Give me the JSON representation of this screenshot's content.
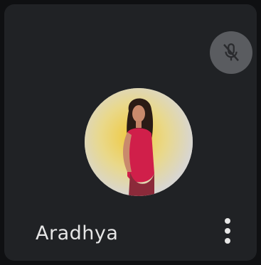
{
  "participant": {
    "name": "Aradhya",
    "avatar_icon": "profile-photo",
    "status_icon": "microphone-off-icon",
    "menu_icon": "more-vert-icon"
  },
  "colors": {
    "tile_background": "#202225",
    "mute_badge": "#5a5c60",
    "text": "#e6e6e6"
  }
}
